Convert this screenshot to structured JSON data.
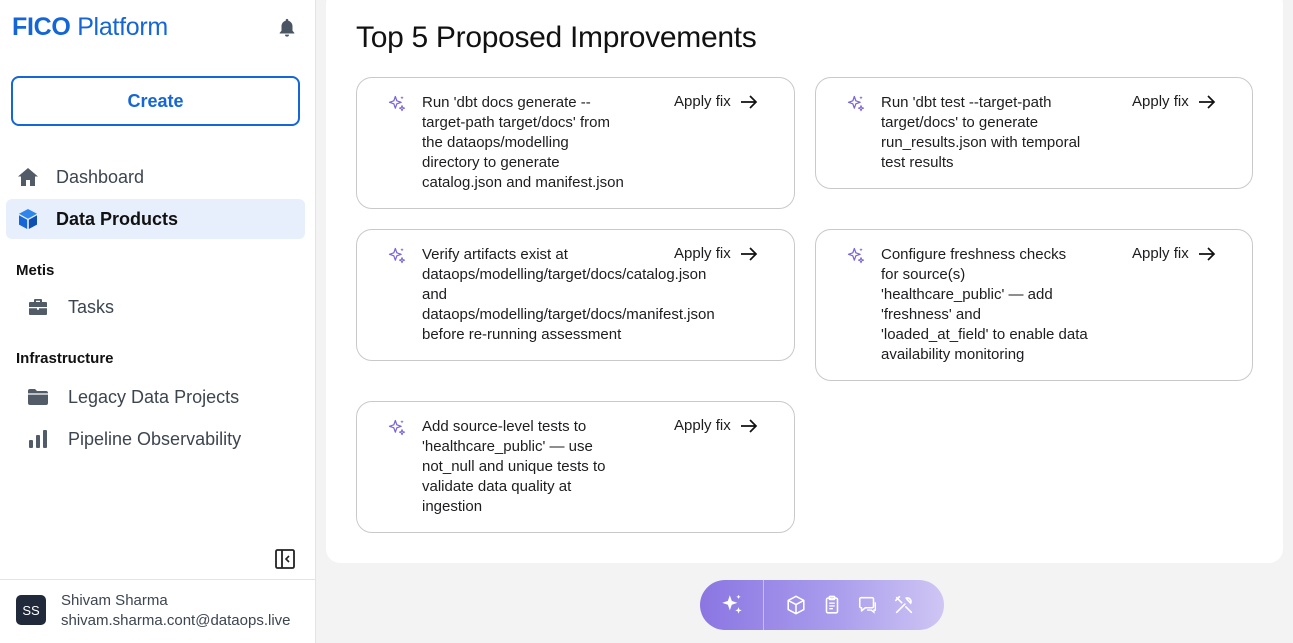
{
  "brand": {
    "bold": "FICO",
    "light": "Platform"
  },
  "sidebar": {
    "create_label": "Create",
    "nav": [
      {
        "label": "Dashboard",
        "icon": "home-icon",
        "active": false
      },
      {
        "label": "Data Products",
        "icon": "cube-icon",
        "active": true
      }
    ],
    "sections": [
      {
        "label": "Metis",
        "items": [
          {
            "label": "Tasks",
            "icon": "briefcase-icon"
          }
        ]
      },
      {
        "label": "Infrastructure",
        "items": [
          {
            "label": "Legacy Data Projects",
            "icon": "folder-icon"
          },
          {
            "label": "Pipeline Observability",
            "icon": "bar-chart-icon"
          }
        ]
      }
    ]
  },
  "user": {
    "initials": "SS",
    "name": "Shivam Sharma",
    "email": "shivam.sharma.cont@dataops.live"
  },
  "main": {
    "title": "Top 5 Proposed Improvements",
    "apply_label": "Apply fix",
    "improvements": [
      {
        "lines": [
          "Run 'dbt docs generate --",
          "target-path target/docs' from",
          "the dataops/modelling",
          "directory to generate",
          "catalog.json and manifest.json"
        ]
      },
      {
        "lines": [
          "Run 'dbt test --target-path",
          "target/docs' to generate",
          "run_results.json with temporal",
          "test results"
        ]
      },
      {
        "lines": [
          "Verify artifacts exist at",
          "dataops/modelling/target/docs/catalog.json",
          "and",
          "dataops/modelling/target/docs/manifest.json",
          "before re-running assessment"
        ]
      },
      {
        "lines": [
          "Configure freshness checks",
          "for source(s)",
          "'healthcare_public' — add",
          "'freshness' and",
          "'loaded_at_field' to enable data",
          "availability monitoring"
        ]
      },
      {
        "lines": [
          "Add source-level tests to",
          "'healthcare_public' — use",
          "not_null and unique tests to",
          "validate data quality at",
          "ingestion"
        ]
      }
    ]
  },
  "toolbar": {
    "icons": [
      "sparkle-icon",
      "cube-icon",
      "clipboard-icon",
      "chat-icon",
      "tools-icon"
    ]
  },
  "colors": {
    "brand_blue": "#1466d6",
    "active_bg": "#e8effc",
    "sparkle": "#7b64d8",
    "toolbar_start": "#8b76e2"
  }
}
